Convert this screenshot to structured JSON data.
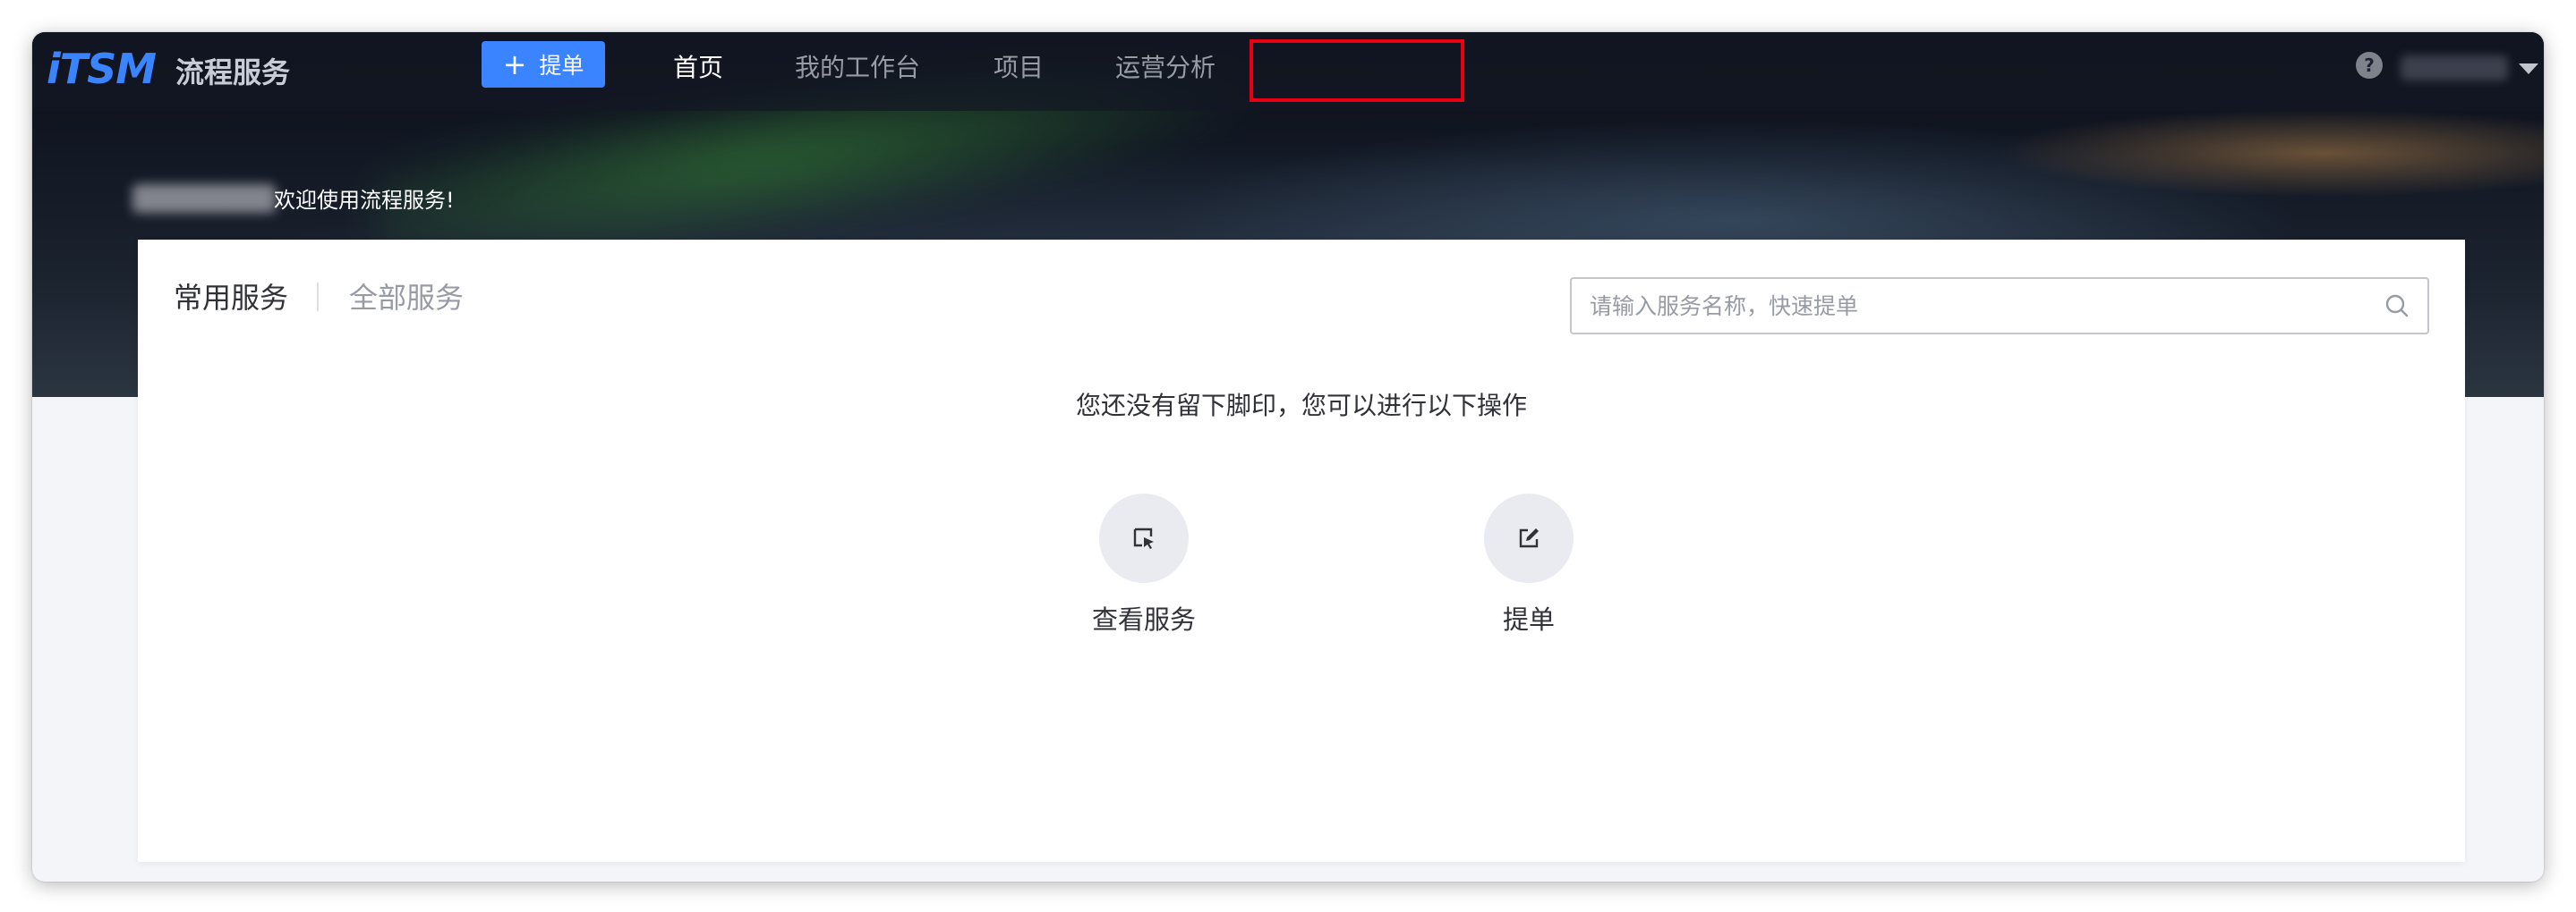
{
  "app": {
    "logo_text": "iTSM",
    "title": "流程服务"
  },
  "header": {
    "create_label": "提单",
    "nav": [
      {
        "label": "首页",
        "active": true
      },
      {
        "label": "我的工作台",
        "active": false
      },
      {
        "label": "项目",
        "active": false
      },
      {
        "label": "运营分析",
        "active": false
      }
    ],
    "help_glyph": "?"
  },
  "welcome": {
    "text": "欢迎使用流程服务!"
  },
  "tabs": [
    {
      "label": "常用服务",
      "active": true
    },
    {
      "label": "全部服务",
      "active": false
    }
  ],
  "search": {
    "placeholder": "请输入服务名称，快速提单",
    "value": ""
  },
  "empty_state": {
    "message": "您还没有留下脚印，您可以进行以下操作",
    "actions": [
      {
        "label": "查看服务",
        "icon": "cursor-select-icon"
      },
      {
        "label": "提单",
        "icon": "edit-icon"
      }
    ]
  },
  "colors": {
    "primary": "#3a84ff",
    "highlight_box": "#e60012",
    "nav_active": "#ffffff",
    "nav_inactive": "#979ba5"
  }
}
